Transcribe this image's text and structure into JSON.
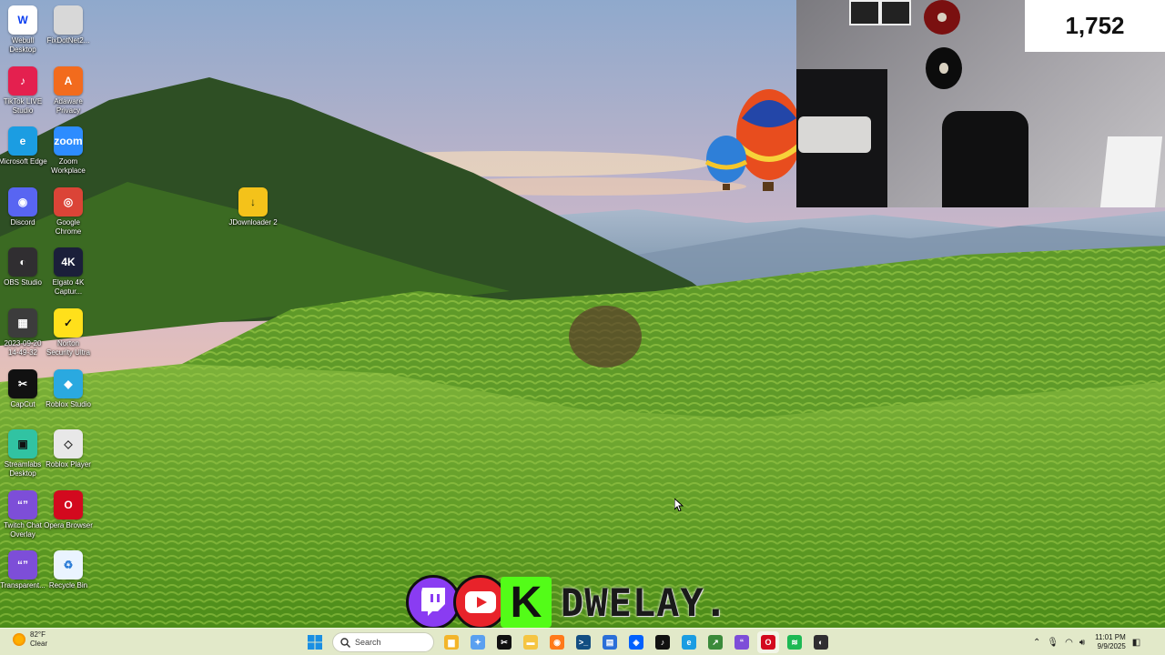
{
  "desktop": {
    "icons": [
      {
        "label": "Webull Desktop",
        "glyph": "W",
        "color": "#0a3df0",
        "bg": "#ffffff",
        "icon": "webull-icon"
      },
      {
        "label": "FixDotNet2...",
        "glyph": "",
        "color": "#888888",
        "bg": "#d8d8d8",
        "icon": "file-icon"
      },
      {
        "label": "TikTok LIVE Studio",
        "glyph": "♪",
        "color": "#ffffff",
        "bg": "#e4204f",
        "icon": "tiktok-live-icon"
      },
      {
        "label": "Adaware Privacy",
        "glyph": "A",
        "color": "#ffffff",
        "bg": "#f26b1d",
        "icon": "adaware-icon"
      },
      {
        "label": "Microsoft Edge",
        "glyph": "e",
        "color": "#ffffff",
        "bg": "#1b9de2",
        "icon": "edge-icon"
      },
      {
        "label": "Zoom Workplace",
        "glyph": "zoom",
        "color": "#ffffff",
        "bg": "#2d8cff",
        "icon": "zoom-icon"
      },
      {
        "label": "Discord",
        "glyph": "◉",
        "color": "#ffffff",
        "bg": "#5865f2",
        "icon": "discord-icon"
      },
      {
        "label": "Google Chrome",
        "glyph": "◎",
        "color": "#ffffff",
        "bg": "#db4437",
        "icon": "chrome-icon"
      },
      {
        "label": "OBS Studio",
        "glyph": "◐",
        "color": "#ffffff",
        "bg": "#302e31",
        "icon": "obs-icon"
      },
      {
        "label": "Elgato 4K Captur...",
        "glyph": "4K",
        "color": "#ffffff",
        "bg": "#1b1f3a",
        "icon": "elgato-icon"
      },
      {
        "label": "2023-09-20 14-49-32",
        "glyph": "▦",
        "color": "#ffffff",
        "bg": "#3c3c3c",
        "icon": "video-file-icon"
      },
      {
        "label": "Norton Security Ultra",
        "glyph": "✓",
        "color": "#111111",
        "bg": "#ffe01b",
        "icon": "norton-icon"
      },
      {
        "label": "CapCut",
        "glyph": "✂",
        "color": "#ffffff",
        "bg": "#111111",
        "icon": "capcut-icon"
      },
      {
        "label": "Roblox Studio",
        "glyph": "◆",
        "color": "#ffffff",
        "bg": "#2aa9e0",
        "icon": "roblox-studio-icon"
      },
      {
        "label": "Streamlabs Desktop",
        "glyph": "▣",
        "color": "#111111",
        "bg": "#31c3a2",
        "icon": "streamlabs-icon"
      },
      {
        "label": "Roblox Player",
        "glyph": "◇",
        "color": "#333333",
        "bg": "#e8e8e8",
        "icon": "roblox-player-icon"
      },
      {
        "label": "Twitch Chat Overlay",
        "glyph": "“”",
        "color": "#ffffff",
        "bg": "#7d4ed8",
        "icon": "chat-overlay-icon"
      },
      {
        "label": "Opera Browser",
        "glyph": "O",
        "color": "#ffffff",
        "bg": "#d3091e",
        "icon": "opera-icon"
      },
      {
        "label": "Transparent...",
        "glyph": "“”",
        "color": "#ffffff",
        "bg": "#7d4ed8",
        "icon": "transparent-overlay-icon"
      },
      {
        "label": "Recycle Bin",
        "glyph": "♻",
        "color": "#2a7bd6",
        "bg": "#eaf4ff",
        "icon": "recycle-bin-icon"
      }
    ],
    "jdownloader": {
      "label": "JDownloader 2",
      "glyph": "↓",
      "color": "#1c2a0b",
      "bg": "#f4c21a",
      "icon": "jdownloader-icon"
    }
  },
  "overlay": {
    "viewer_count": "1,752",
    "channel_name": "DWELAY."
  },
  "taskbar": {
    "weather": {
      "temp": "82°F",
      "condition": "Clear"
    },
    "search_placeholder": "Search",
    "apps": [
      {
        "name": "file-explorer-icon",
        "glyph": "▆",
        "bg": "#f3b52a"
      },
      {
        "name": "copilot-icon",
        "glyph": "✦",
        "bg": "#5aa0f0"
      },
      {
        "name": "capcut-taskbar-icon",
        "glyph": "✂",
        "bg": "#111111"
      },
      {
        "name": "folder-icon",
        "glyph": "▬",
        "bg": "#f5c542"
      },
      {
        "name": "firefox-icon",
        "glyph": "◉",
        "bg": "#ff7a1a"
      },
      {
        "name": "terminal-icon",
        "glyph": ">_",
        "bg": "#134e82"
      },
      {
        "name": "store-icon",
        "glyph": "▤",
        "bg": "#2b6fd8"
      },
      {
        "name": "dropbox-icon",
        "glyph": "◈",
        "bg": "#0061fe"
      },
      {
        "name": "tiktok-icon",
        "glyph": "♪",
        "bg": "#111111"
      },
      {
        "name": "edge-taskbar-icon",
        "glyph": "e",
        "bg": "#1b9de2"
      },
      {
        "name": "chart-app-icon",
        "glyph": "↗",
        "bg": "#3b8a3b"
      },
      {
        "name": "chat-taskbar-icon",
        "glyph": "“",
        "bg": "#7d4ed8"
      },
      {
        "name": "opera-taskbar-icon",
        "glyph": "O",
        "bg": "#d3091e"
      },
      {
        "name": "spotify-icon",
        "glyph": "≋",
        "bg": "#1db954"
      },
      {
        "name": "obs-taskbar-icon",
        "glyph": "◐",
        "bg": "#302e31"
      }
    ],
    "time": "11:01 PM",
    "date": "9/9/2025"
  }
}
